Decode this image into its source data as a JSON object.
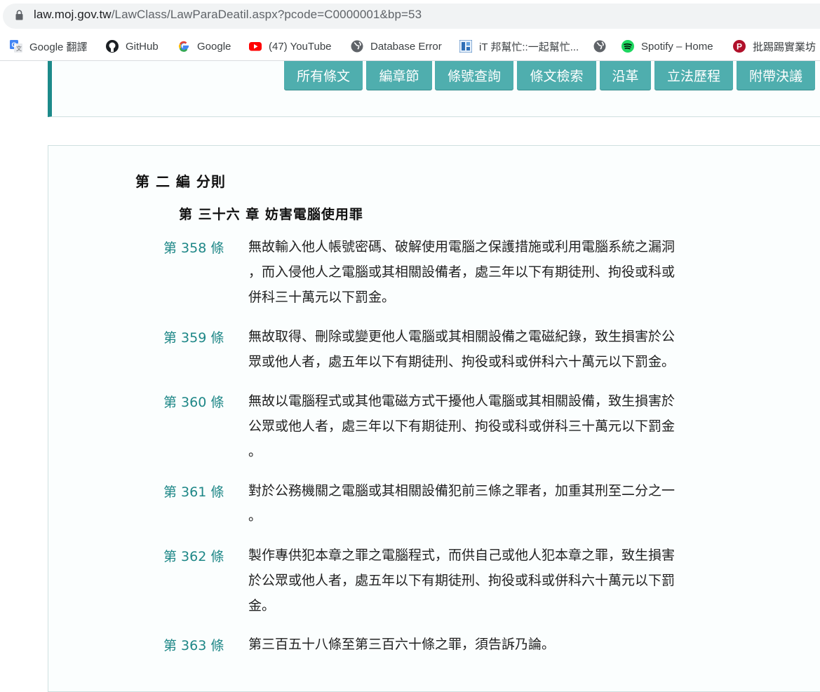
{
  "browser": {
    "url_host": "law.moj.gov.tw",
    "url_path": "/LawClass/LawParaDeatil.aspx?pcode=C0000001&bp=53",
    "bookmarks": [
      {
        "label": "Google 翻譯",
        "icon": "google-translate-icon"
      },
      {
        "label": "GitHub",
        "icon": "github-icon"
      },
      {
        "label": "Google",
        "icon": "google-icon"
      },
      {
        "label": "(47) YouTube",
        "icon": "youtube-icon"
      },
      {
        "label": "Database Error",
        "icon": "globe-icon"
      },
      {
        "label": "iT 邦幫忙::一起幫忙...",
        "icon": "ithome-icon"
      },
      {
        "label": "",
        "icon": "globe-icon"
      },
      {
        "label": "Spotify – Home",
        "icon": "spotify-icon"
      },
      {
        "label": "批踢踢實業坊",
        "icon": "ptt-icon"
      }
    ]
  },
  "nav": {
    "buttons": [
      "所有條文",
      "編章節",
      "條號查詢",
      "條文檢索",
      "沿革",
      "立法歷程",
      "附帶決議"
    ]
  },
  "heading": {
    "part": "第 二 編 分則",
    "chapter": "第 三十六 章 妨害電腦使用罪"
  },
  "articles": [
    {
      "number": "第 358 條",
      "lines": [
        "無故輸入他人帳號密碼、破解使用電腦之保護措施或利用電腦系統之漏洞",
        "，而入侵他人之電腦或其相關設備者，處三年以下有期徒刑、拘役或科或",
        "併科三十萬元以下罰金。"
      ]
    },
    {
      "number": "第 359 條",
      "lines": [
        "無故取得、刪除或變更他人電腦或其相關設備之電磁紀錄，致生損害於公",
        "眾或他人者，處五年以下有期徒刑、拘役或科或併科六十萬元以下罰金。"
      ]
    },
    {
      "number": "第 360 條",
      "lines": [
        "無故以電腦程式或其他電磁方式干擾他人電腦或其相關設備，致生損害於",
        "公眾或他人者，處三年以下有期徒刑、拘役或科或併科三十萬元以下罰金",
        "。"
      ]
    },
    {
      "number": "第 361 條",
      "lines": [
        "對於公務機關之電腦或其相關設備犯前三條之罪者，加重其刑至二分之一",
        "。"
      ]
    },
    {
      "number": "第 362 條",
      "lines": [
        "製作專供犯本章之罪之電腦程式，而供自己或他人犯本章之罪，致生損害",
        "於公眾或他人者，處五年以下有期徒刑、拘役或科或併科六十萬元以下罰",
        "金。"
      ]
    },
    {
      "number": "第 363 條",
      "lines": [
        "第三百五十八條至第三百六十條之罪，須告訴乃論。"
      ]
    }
  ],
  "colors": {
    "accent": "#1e8787",
    "button_bg": "#4faeae",
    "border": "#1c8a8a"
  }
}
